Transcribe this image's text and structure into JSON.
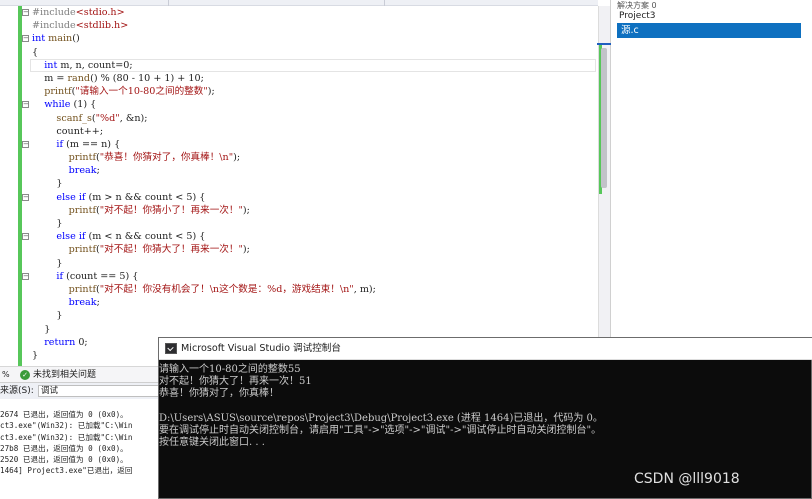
{
  "code_lines": [
    {
      "t": "#include<stdio.h>",
      "fold": "−"
    },
    {
      "t": "#include<stdlib.h>"
    },
    {
      "t": "int main()",
      "fold": "−"
    },
    {
      "t": "{"
    },
    {
      "t": "    int m, n, count=0;"
    },
    {
      "t": "    m = rand() % (80 - 10 + 1) + 10;"
    },
    {
      "t": "    printf(\"请输入一个10-80之间的整数\");"
    },
    {
      "t": "    while (1) {",
      "fold": "−"
    },
    {
      "t": "        scanf_s(\"%d\", &n);"
    },
    {
      "t": "        count++;"
    },
    {
      "t": "        if (m == n) {",
      "fold": "−"
    },
    {
      "t": "            printf(\"恭喜！你猜对了，你真棒！\\n\");"
    },
    {
      "t": "            break;"
    },
    {
      "t": "        }"
    },
    {
      "t": "        else if (m > n && count < 5) {",
      "fold": "−"
    },
    {
      "t": "            printf(\"对不起！你猜小了！再来一次！\");"
    },
    {
      "t": "        }"
    },
    {
      "t": "        else if (m < n && count < 5) {",
      "fold": "−"
    },
    {
      "t": "            printf(\"对不起！你猜大了！再来一次！\");"
    },
    {
      "t": "        }"
    },
    {
      "t": "        if (count == 5) {",
      "fold": "−"
    },
    {
      "t": "            printf(\"对不起！你没有机会了！\\n这个数是：%d，游戏结束！\\n\", m);"
    },
    {
      "t": "            break;"
    },
    {
      "t": "        }"
    },
    {
      "t": "    }"
    },
    {
      "t": "    return 0;"
    },
    {
      "t": "}"
    }
  ],
  "solution": {
    "header": "解决方案 0",
    "project": "Project3",
    "file": "源.c"
  },
  "status": {
    "zoom": "%",
    "text": "未找到相关问题"
  },
  "output": {
    "source_label": "来源(S):",
    "source_value": "调试",
    "lines": [
      "2674 已退出，返回值为 0 (0x0)。",
      "ct3.exe\"(Win32): 已加载\"C:\\Win",
      "ct3.exe\"(Win32): 已加载\"C:\\Win",
      "27b8 已退出，返回值为 0 (0x0)。",
      "2520 已退出，返回值为 0 (0x0)。",
      "1464] Project3.exe\"已退出，返回"
    ]
  },
  "console": {
    "title": "Microsoft Visual Studio 调试控制台",
    "lines": [
      "请输入一个10-80之间的整数55",
      "对不起！你猜大了！再来一次！51",
      "恭喜！你猜对了，你真棒！",
      "",
      "D:\\Users\\ASUS\\source\\repos\\Project3\\Debug\\Project3.exe (进程 1464)已退出，代码为 0。",
      "要在调试停止时自动关闭控制台，请启用\"工具\"->\"选项\"->\"调试\"->\"调试停止时自动关闭控制台\"。",
      "按任意键关闭此窗口. . ."
    ]
  },
  "watermark": "CSDN @lll9018",
  "colors": {
    "keyword": "#0000ff",
    "string": "#a31515",
    "selection": "#0e70c0",
    "console_bg": "#0c0c0c",
    "change_bar": "#57c75a"
  }
}
